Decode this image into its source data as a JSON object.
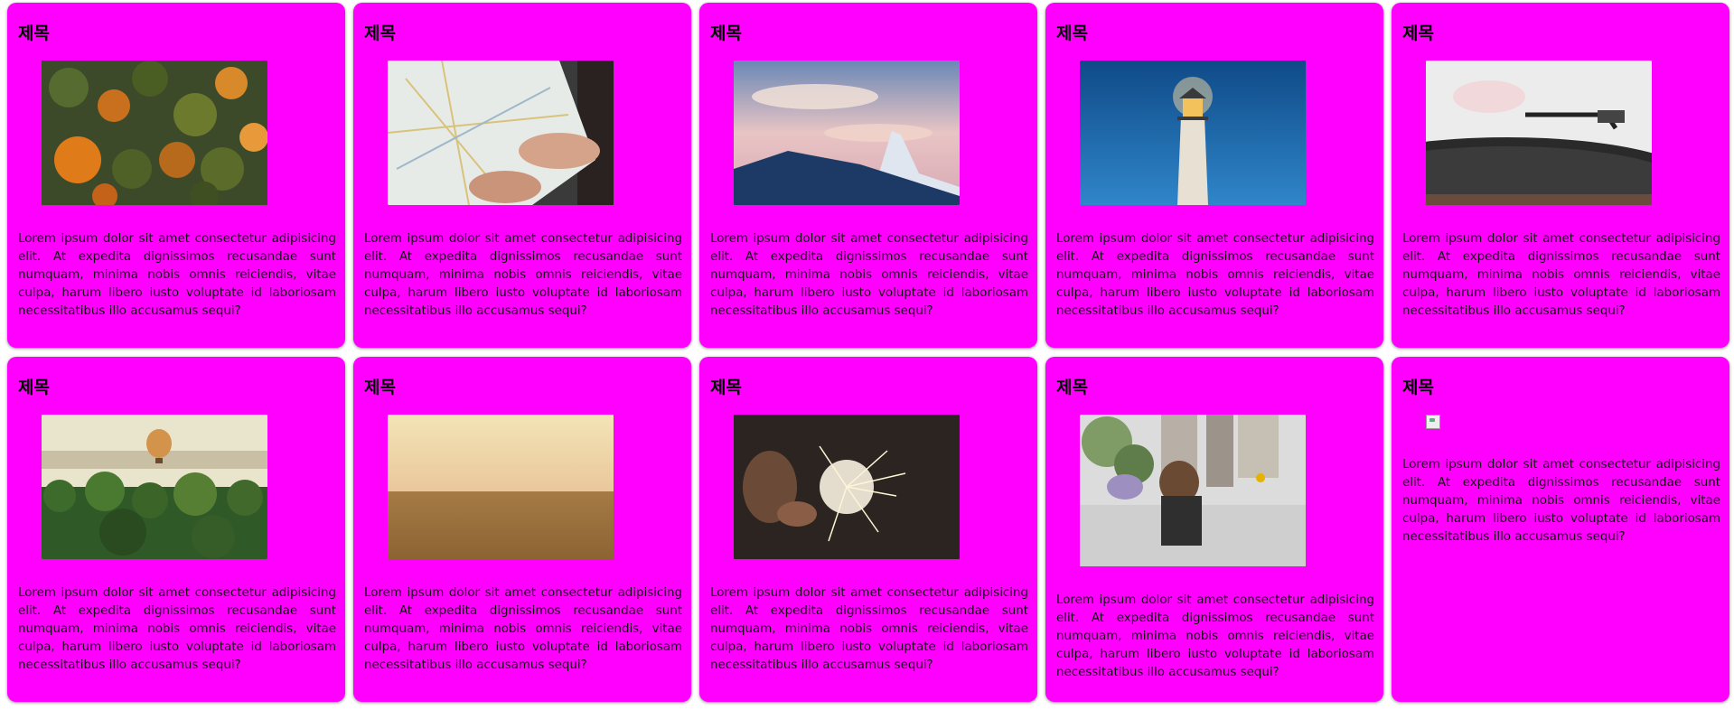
{
  "cards": [
    {
      "title": "제목",
      "image": "forest-aerial",
      "text": "Lorem ipsum dolor sit amet consectetur adipisicing elit. At expedita dignissimos recusandae sunt numquam, minima nobis omnis reiciendis, vitae culpa, harum libero iusto voluptate id laboriosam necessitatibus illo accusamus sequi?"
    },
    {
      "title": "제목",
      "image": "hands-holding-map",
      "text": "Lorem ipsum dolor sit amet consectetur adipisicing elit. At expedita dignissimos recusandae sunt numquam, minima nobis omnis reiciendis, vitae culpa, harum libero iusto voluptate id laboriosam necessitatibus illo accusamus sequi?"
    },
    {
      "title": "제목",
      "image": "snowy-mountain-peak",
      "text": "Lorem ipsum dolor sit amet consectetur adipisicing elit. At expedita dignissimos recusandae sunt numquam, minima nobis omnis reiciendis, vitae culpa, harum libero iusto voluptate id laboriosam necessitatibus illo accusamus sequi?"
    },
    {
      "title": "제목",
      "image": "lighthouse-night",
      "text": "Lorem ipsum dolor sit amet consectetur adipisicing elit. At expedita dignissimos recusandae sunt numquam, minima nobis omnis reiciendis, vitae culpa, harum libero iusto voluptate id laboriosam necessitatibus illo accusamus sequi?"
    },
    {
      "title": "제목",
      "image": "record-player",
      "text": "Lorem ipsum dolor sit amet consectetur adipisicing elit. At expedita dignissimos recusandae sunt numquam, minima nobis omnis reiciendis, vitae culpa, harum libero iusto voluptate id laboriosam necessitatibus illo accusamus sequi?"
    },
    {
      "title": "제목",
      "image": "hot-air-balloon-palms",
      "text": "Lorem ipsum dolor sit amet consectetur adipisicing elit. At expedita dignissimos recusandae sunt numquam, minima nobis omnis reiciendis, vitae culpa, harum libero iusto voluptate id laboriosam necessitatibus illo accusamus sequi?"
    },
    {
      "title": "제목",
      "image": "desert-sand",
      "text": "Lorem ipsum dolor sit amet consectetur adipisicing elit. At expedita dignissimos recusandae sunt numquam, minima nobis omnis reiciendis, vitae culpa, harum libero iusto voluptate id laboriosam necessitatibus illo accusamus sequi?"
    },
    {
      "title": "제목",
      "image": "sparkler",
      "text": "Lorem ipsum dolor sit amet consectetur adipisicing elit. At expedita dignissimos recusandae sunt numquam, minima nobis omnis reiciendis, vitae culpa, harum libero iusto voluptate id laboriosam necessitatibus illo accusamus sequi?"
    },
    {
      "title": "제목",
      "image": "mother-child-street",
      "text": "Lorem ipsum dolor sit amet consectetur adipisicing elit. At expedita dignissimos recusandae sunt numquam, minima nobis omnis reiciendis, vitae culpa, harum libero iusto voluptate id laboriosam necessitatibus illo accusamus sequi?"
    },
    {
      "title": "제목",
      "image": "broken-image-icon",
      "text": "Lorem ipsum dolor sit amet consectetur adipisicing elit. At expedita dignissimos recusandae sunt numquam, minima nobis omnis reiciendis, vitae culpa, harum libero iusto voluptate id laboriosam necessitatibus illo accusamus sequi?"
    }
  ],
  "colors": {
    "card_background": "#ff00ff",
    "text": "#111111"
  }
}
